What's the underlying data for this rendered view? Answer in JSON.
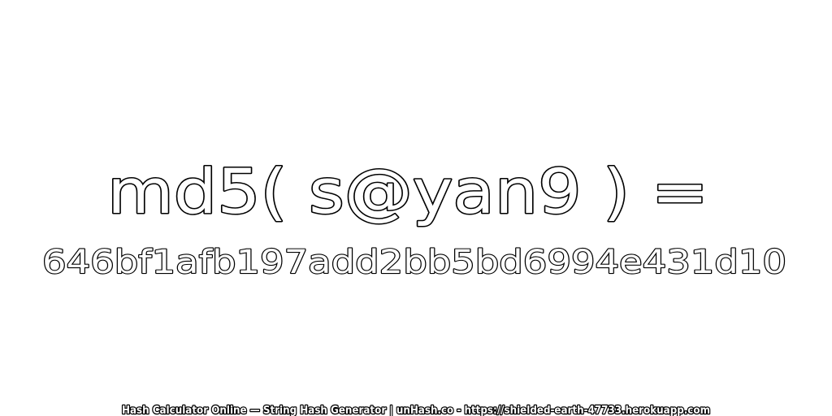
{
  "title": "md5( s@yan9 ) =",
  "hash": "646bf1afb197add2bb5bd6994e431d10",
  "footer": "Hash Calculator Online — String Hash Generator | unHash.co - https://shielded-earth-47733.herokuapp.com"
}
